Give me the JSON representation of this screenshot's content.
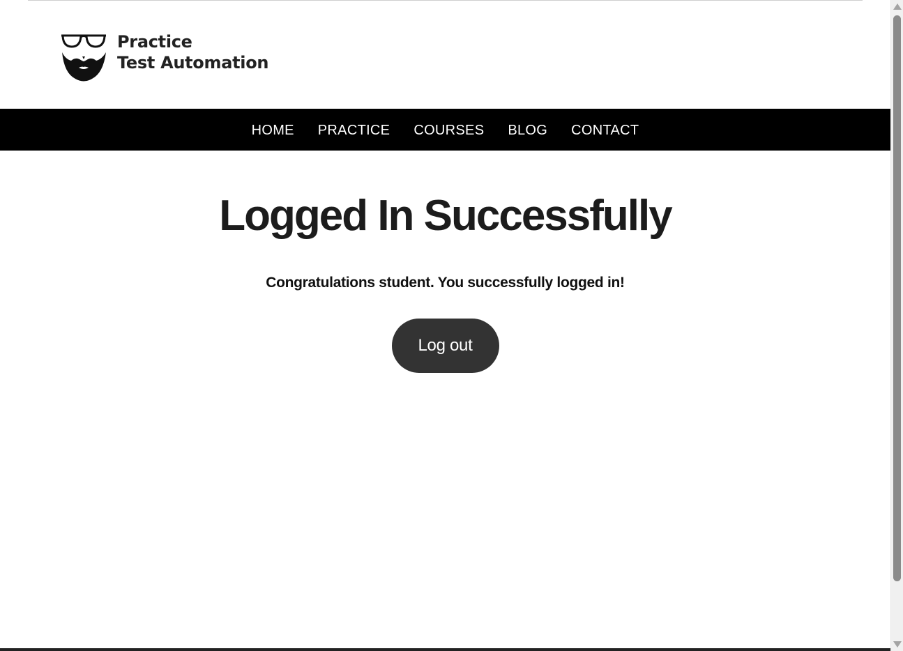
{
  "site": {
    "logo_line1": "Practice",
    "logo_line2": "Test Automation",
    "logo_icon": "glasses-beard-icon"
  },
  "nav": {
    "items": [
      {
        "label": "HOME"
      },
      {
        "label": "PRACTICE"
      },
      {
        "label": "COURSES"
      },
      {
        "label": "BLOG"
      },
      {
        "label": "CONTACT"
      }
    ]
  },
  "main": {
    "title": "Logged In Successfully",
    "message": "Congratulations student. You successfully logged in!",
    "logout_label": "Log out"
  },
  "colors": {
    "nav_background": "#000000",
    "nav_text": "#ffffff",
    "button_background": "#333333",
    "title_text": "#1c1c1c"
  }
}
